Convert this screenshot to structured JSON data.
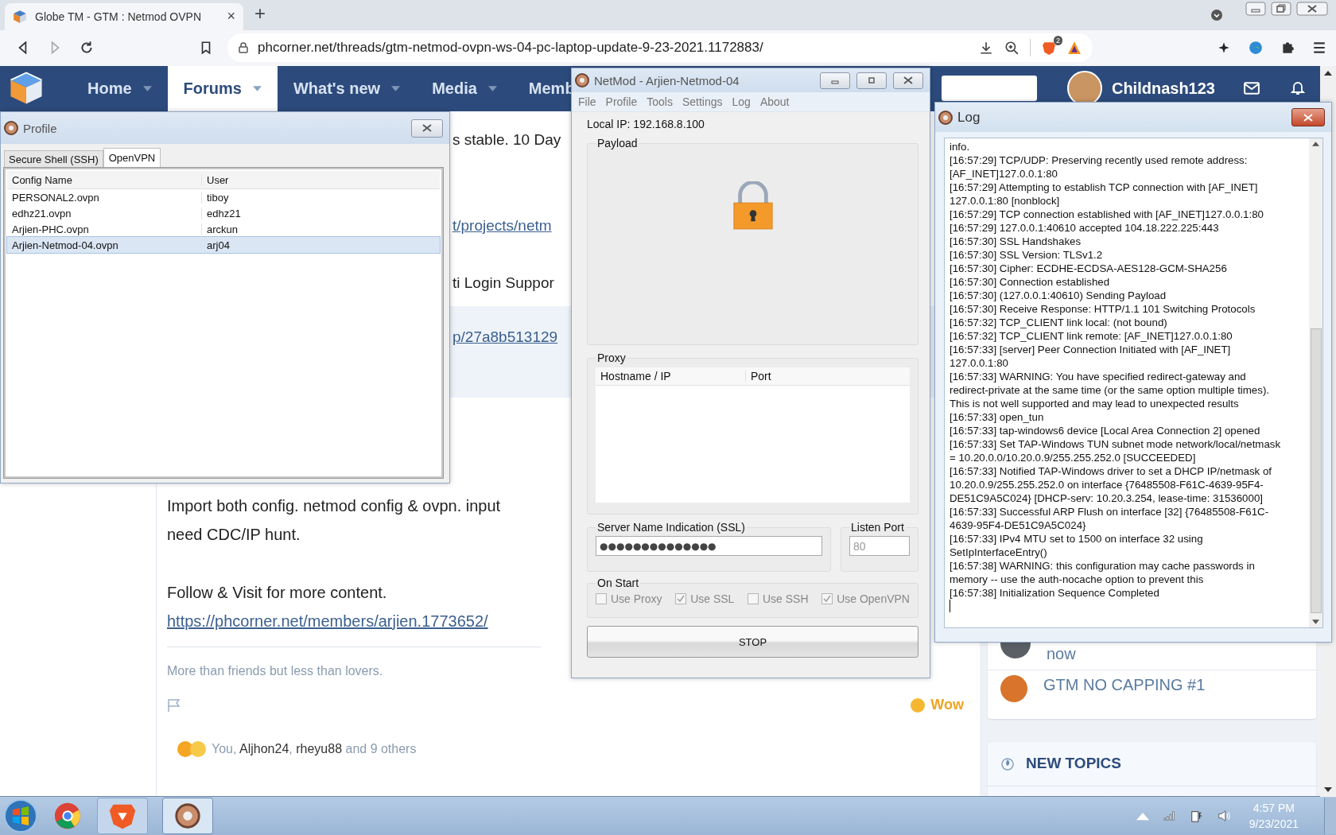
{
  "browser": {
    "tab": {
      "title": "Globe TM - GTM : Netmod OVPN",
      "close": "×"
    },
    "new_tab": "+",
    "url": "phcorner.net/threads/gtm-netmod-ovpn-ws-04-pc-laptop-update-9-23-2021.1172883/",
    "shield_count": "2"
  },
  "site_nav": {
    "items": [
      {
        "label": "Home",
        "selected": false,
        "menu": true
      },
      {
        "label": "Forums",
        "selected": true,
        "menu": true
      },
      {
        "label": "What's new",
        "selected": false,
        "menu": true
      },
      {
        "label": "Media",
        "selected": false,
        "menu": true
      },
      {
        "label": "Memb",
        "selected": false,
        "menu": false
      }
    ],
    "username": "Childnash123"
  },
  "post": {
    "fragments": [
      {
        "kind": "text",
        "text": "s stable. 10 Day",
        "boxed": false
      },
      {
        "kind": "link",
        "text": "t/projects/netm",
        "boxed": false
      },
      {
        "kind": "text",
        "text": "ti Login Suppor",
        "boxed": false
      },
      {
        "kind": "link",
        "text": "p/27a8b513129",
        "boxed": true
      }
    ],
    "body_lines": [
      "Import both config. netmod config & ovpn. input",
      "need CDC/IP hunt."
    ],
    "follow": "Follow & Visit for more content.",
    "member_link": "https://phcorner.net/members/arjien.1773652/",
    "signature": "More than friends but less than lovers.",
    "reaction": "Wow",
    "reactors": [
      {
        "kind": "text",
        "text": "You,"
      },
      {
        "kind": "link",
        "text": "Aljhon24"
      },
      {
        "kind": "text",
        "text": ","
      },
      {
        "kind": "link",
        "text": "rheyu88"
      },
      {
        "kind": "text",
        "text": "and 9 others"
      }
    ]
  },
  "sidebar": {
    "items": [
      {
        "title": "now"
      },
      {
        "title": "GTM NO CAPPING #1"
      }
    ],
    "section": "NEW TOPICS"
  },
  "profile_window": {
    "title": "Profile",
    "tabs": [
      {
        "label": "Secure Shell (SSH)",
        "selected": false
      },
      {
        "label": "OpenVPN",
        "selected": true
      }
    ],
    "columns": [
      "Config Name",
      "User"
    ],
    "rows": [
      {
        "cells": [
          "PERSONAL2.ovpn",
          "tiboy"
        ],
        "selected": false
      },
      {
        "cells": [
          "edhz21.ovpn",
          "edhz21"
        ],
        "selected": false
      },
      {
        "cells": [
          "Arjien-PHC.ovpn",
          "arckun"
        ],
        "selected": false
      },
      {
        "cells": [
          "Arjien-Netmod-04.ovpn",
          "arj04"
        ],
        "selected": true
      }
    ]
  },
  "netmod_window": {
    "title": "NetMod - Arjien-Netmod-04",
    "menu": [
      "File",
      "Profile",
      "Tools",
      "Settings",
      "Log",
      "About"
    ],
    "local_ip": "Local IP: 192.168.8.100",
    "payload_label": "Payload",
    "proxy_label": "Proxy",
    "proxy_columns": [
      "Hostname / IP",
      "Port"
    ],
    "sni_label": "Server Name Indication (SSL)",
    "sni_value": "●●●●●●●●●●●●●●",
    "port_label": "Listen Port",
    "port_value": "80",
    "on_start_label": "On Start",
    "options": [
      {
        "label": "Use Proxy",
        "checked": false
      },
      {
        "label": "Use SSL",
        "checked": true
      },
      {
        "label": "Use SSH",
        "checked": false
      },
      {
        "label": "Use OpenVPN",
        "checked": true
      }
    ],
    "button": "STOP"
  },
  "log_window": {
    "title": "Log",
    "lines": [
      "info.",
      "[16:57:29] TCP/UDP: Preserving recently used remote address: [AF_INET]127.0.0.1:80",
      "[16:57:29] Attempting to establish TCP connection with [AF_INET] 127.0.0.1:80 [nonblock]",
      "[16:57:29] TCP connection established with [AF_INET]127.0.0.1:80",
      "[16:57:29] 127.0.0.1:40610 accepted 104.18.222.225:443",
      "[16:57:30] SSL Handshakes",
      "[16:57:30] SSL Version: TLSv1.2",
      "[16:57:30] Cipher: ECDHE-ECDSA-AES128-GCM-SHA256",
      "[16:57:30] Connection established",
      "[16:57:30] (127.0.0.1:40610) Sending Payload",
      "[16:57:30] Receive Response: HTTP/1.1 101 Switching Protocols",
      "[16:57:32] TCP_CLIENT link local: (not bound)",
      "[16:57:32] TCP_CLIENT link remote: [AF_INET]127.0.0.1:80",
      "[16:57:33] [server] Peer Connection Initiated with [AF_INET] 127.0.0.1:80",
      "[16:57:33] WARNING: You have specified redirect-gateway and redirect-private at the same time (or the same option multiple times). This is not well supported and may lead to unexpected results",
      "[16:57:33] open_tun",
      "[16:57:33] tap-windows6 device [Local Area Connection 2] opened",
      "[16:57:33] Set TAP-Windows TUN subnet mode network/local/netmask = 10.20.0.0/10.20.0.9/255.255.252.0 [SUCCEEDED]",
      "[16:57:33] Notified TAP-Windows driver to set a DHCP IP/netmask of 10.20.0.9/255.255.252.0 on interface {76485508-F61C-4639-95F4-DE51C9A5C024} [DHCP-serv: 10.20.3.254, lease-time: 31536000]",
      "[16:57:33] Successful ARP Flush on interface [32] {76485508-F61C-4639-95F4-DE51C9A5C024}",
      "[16:57:33] IPv4 MTU set to 1500 on interface 32 using SetIpInterfaceEntry()",
      "[16:57:38] WARNING: this configuration may cache passwords in memory -- use the auth-nocache option to prevent this",
      "[16:57:38] Initialization Sequence Completed"
    ]
  },
  "taskbar": {
    "time": "4:57 PM",
    "date": "9/23/2021"
  }
}
